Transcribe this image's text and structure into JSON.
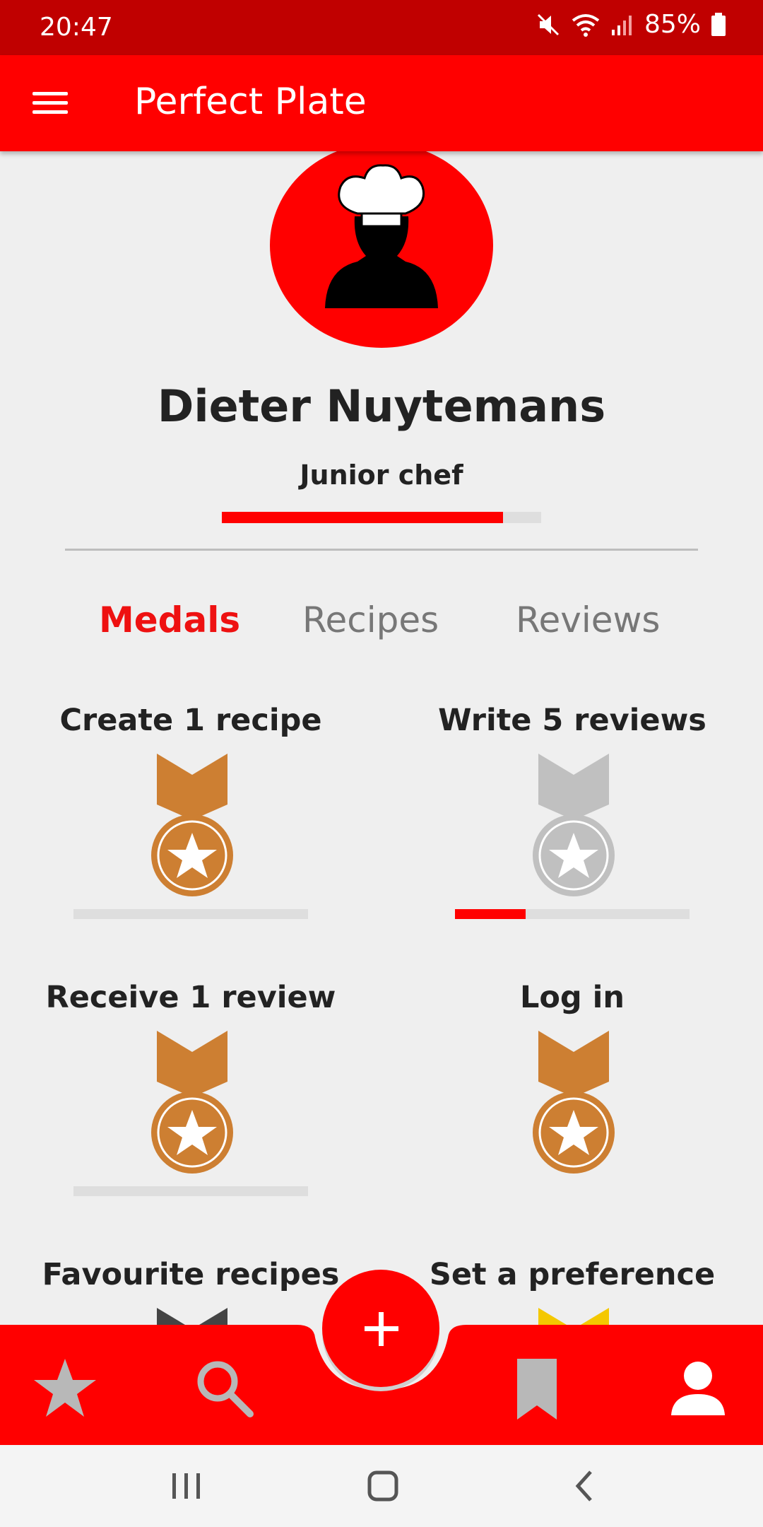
{
  "status_bar": {
    "time": "20:47",
    "battery": "85%"
  },
  "app_bar": {
    "title": "Perfect Plate"
  },
  "profile": {
    "name": "Dieter Nuytemans",
    "rank": "Junior chef",
    "rank_progress": 0.88
  },
  "tabs": [
    {
      "label": "Medals",
      "active": true
    },
    {
      "label": "Recipes",
      "active": false
    },
    {
      "label": "Reviews",
      "active": false
    }
  ],
  "medals": [
    {
      "label": "Create 1 recipe",
      "color": "#cd7f32",
      "progress": 0
    },
    {
      "label": "Write 5 reviews",
      "color": "#c0c0c0",
      "progress": 0.3
    },
    {
      "label": "Receive 1 review",
      "color": "#cd7f32",
      "progress": 0
    },
    {
      "label": "Log in",
      "color": "#cd7f32",
      "progress": null
    },
    {
      "label": "Favourite recipes",
      "color": "#444444",
      "progress": null
    },
    {
      "label": "Set a preference",
      "color": "#f4c800",
      "progress": null
    }
  ],
  "bottom_nav": {
    "items": [
      {
        "icon": "star-icon"
      },
      {
        "icon": "search-icon"
      },
      {
        "icon": "add-icon"
      },
      {
        "icon": "bookmark-icon"
      },
      {
        "icon": "profile-icon"
      }
    ]
  },
  "colors": {
    "primary": "#ff0000",
    "status_bar": "#c00000",
    "background": "#efefef"
  }
}
